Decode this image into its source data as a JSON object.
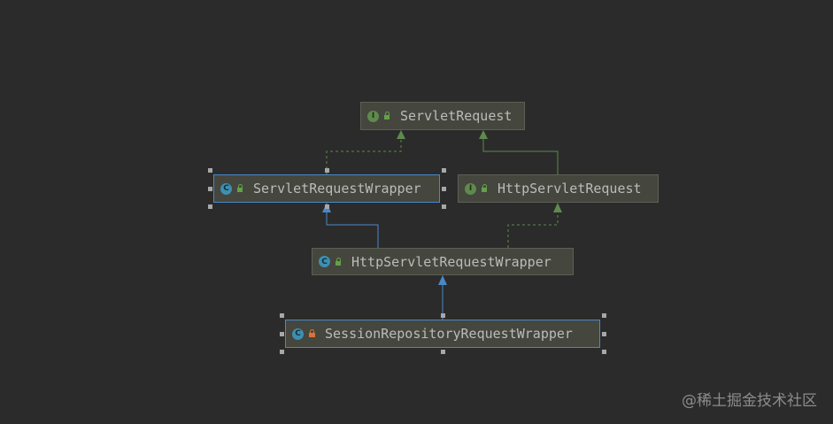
{
  "nodes": [
    {
      "id": "servlet-request",
      "label": "ServletRequest",
      "kind": "interface",
      "badge_icon": "interface-icon",
      "badge_letter": "I",
      "access": "public"
    },
    {
      "id": "servlet-request-wrapper",
      "label": "ServletRequestWrapper",
      "kind": "class",
      "badge_icon": "class-icon",
      "badge_letter": "C",
      "access": "public",
      "selected": true
    },
    {
      "id": "http-servlet-request",
      "label": "HttpServletRequest",
      "kind": "interface",
      "badge_icon": "interface-icon",
      "badge_letter": "I",
      "access": "public"
    },
    {
      "id": "http-servlet-request-wrapper",
      "label": "HttpServletRequestWrapper",
      "kind": "class",
      "badge_icon": "class-icon",
      "badge_letter": "C",
      "access": "public"
    },
    {
      "id": "session-repository-request-wrapper",
      "label": "SessionRepositoryRequestWrapper",
      "kind": "class",
      "badge_icon": "inner-class-icon",
      "badge_letter": "C",
      "access": "private",
      "selected": true
    }
  ],
  "edges": [
    {
      "from": "servlet-request-wrapper",
      "to": "servlet-request",
      "type": "implements"
    },
    {
      "from": "http-servlet-request",
      "to": "servlet-request",
      "type": "extends-interface"
    },
    {
      "from": "http-servlet-request-wrapper",
      "to": "servlet-request-wrapper",
      "type": "extends"
    },
    {
      "from": "http-servlet-request-wrapper",
      "to": "http-servlet-request",
      "type": "implements"
    },
    {
      "from": "session-repository-request-wrapper",
      "to": "http-servlet-request-wrapper",
      "type": "extends"
    }
  ],
  "colors": {
    "background": "#2b2b2b",
    "node_fill": "#45463e",
    "extends_edge": "#4a88c7",
    "interface_edge": "#5f8a4e",
    "selection_border": "#4a88c7"
  },
  "watermark": "@稀土掘金技术社区"
}
